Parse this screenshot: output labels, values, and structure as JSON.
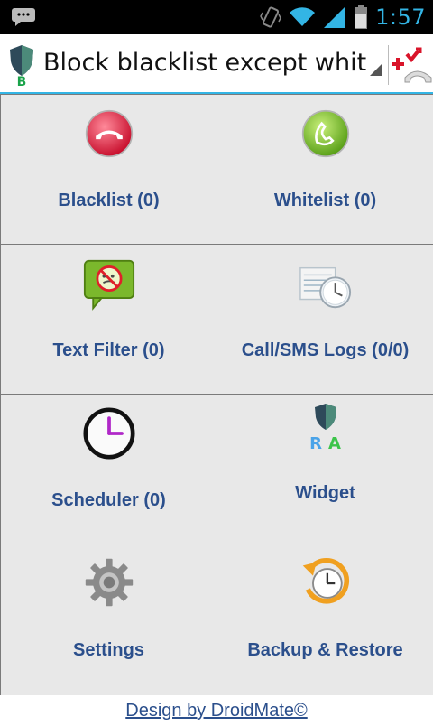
{
  "status_bar": {
    "time": "1:57",
    "icons": [
      "notification-chat-icon",
      "vibrate-icon",
      "wifi-icon",
      "signal-icon",
      "battery-icon"
    ]
  },
  "action_bar": {
    "mode_selector_text": "Block blacklist except whitelist",
    "app_logo_letter": "B",
    "icons": [
      "app-shield-icon",
      "spinner-arrow-icon",
      "add-block-call-icon"
    ]
  },
  "tiles": [
    {
      "id": "blacklist",
      "label": "Blacklist (0)",
      "icon": "red-phone-icon"
    },
    {
      "id": "whitelist",
      "label": "Whitelist (0)",
      "icon": "green-phone-icon"
    },
    {
      "id": "text-filter",
      "label": "Text Filter (0)",
      "icon": "sms-blocked-icon"
    },
    {
      "id": "logs",
      "label": "Call/SMS Logs (0/0)",
      "icon": "log-clock-icon"
    },
    {
      "id": "scheduler",
      "label": "Scheduler (0)",
      "icon": "clock-icon"
    },
    {
      "id": "widget",
      "label": "Widget",
      "icon": "widget-shield-icon",
      "icon_letters": "R A"
    },
    {
      "id": "settings",
      "label": "Settings",
      "icon": "gear-icon"
    },
    {
      "id": "backup",
      "label": "Backup & Restore",
      "icon": "backup-clock-icon"
    }
  ],
  "footer": {
    "link_text": "Design by DroidMate©"
  },
  "colors": {
    "accent": "#33b5e5",
    "label": "#2b4f8c",
    "tile_bg": "#e8e8e8"
  }
}
